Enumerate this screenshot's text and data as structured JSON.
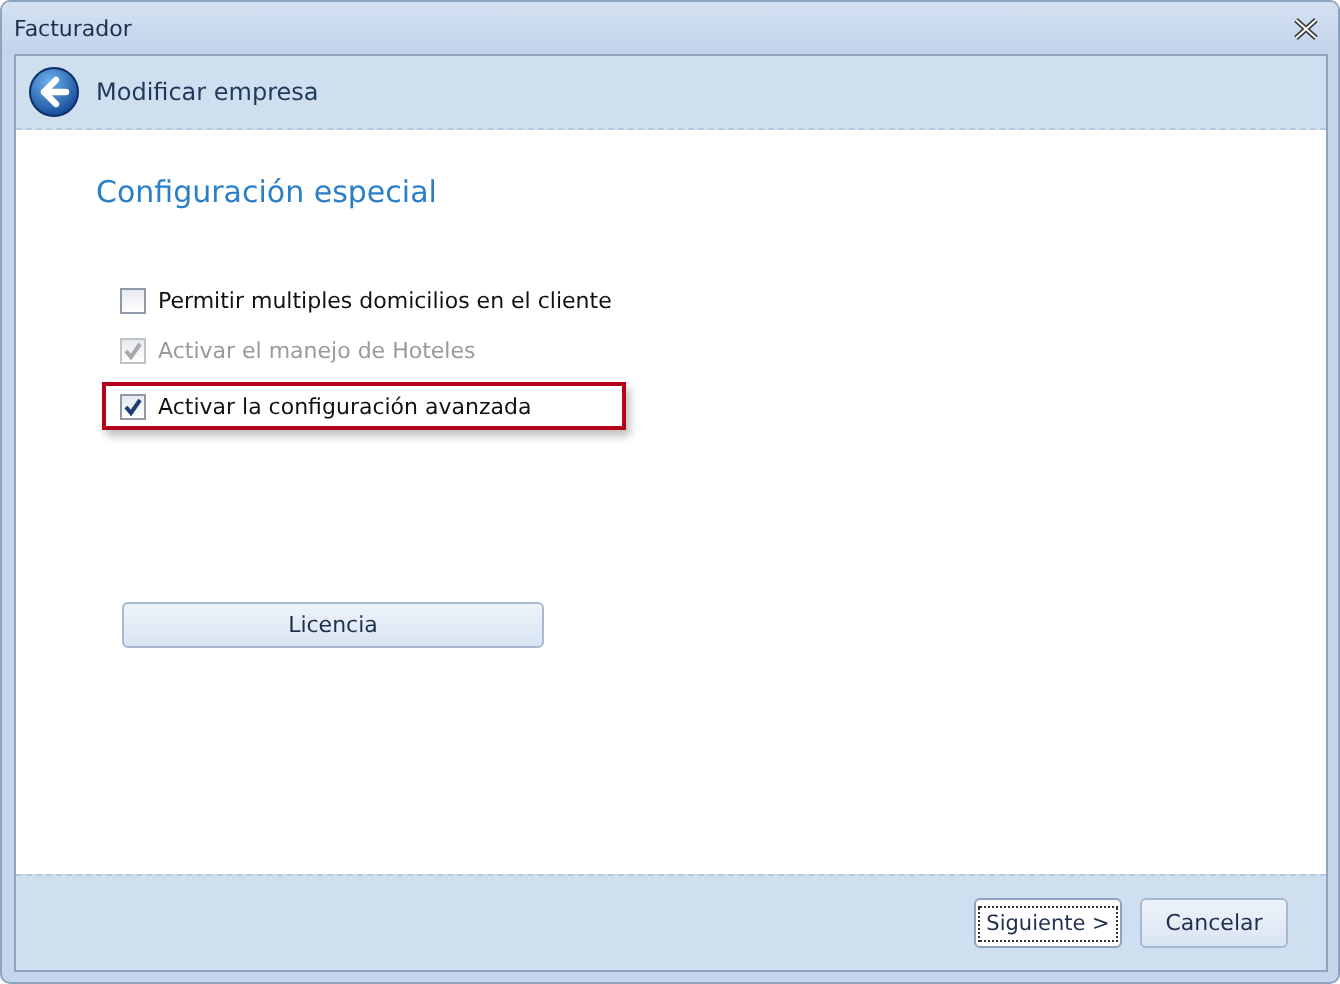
{
  "window": {
    "title": "Facturador"
  },
  "header": {
    "title": "Modificar empresa"
  },
  "section": {
    "title": "Configuración especial"
  },
  "options": [
    {
      "label": "Permitir multiples domicilios en el cliente",
      "checked": false,
      "disabled": false,
      "highlighted": false
    },
    {
      "label": "Activar el manejo de Hoteles",
      "checked": true,
      "disabled": true,
      "highlighted": false
    },
    {
      "label": "Activar la configuración avanzada",
      "checked": true,
      "disabled": false,
      "highlighted": true
    }
  ],
  "license_button": "Licencia",
  "buttons": [
    {
      "label": "Siguiente >",
      "focused": true
    },
    {
      "label": "Cancelar",
      "focused": false
    }
  ]
}
